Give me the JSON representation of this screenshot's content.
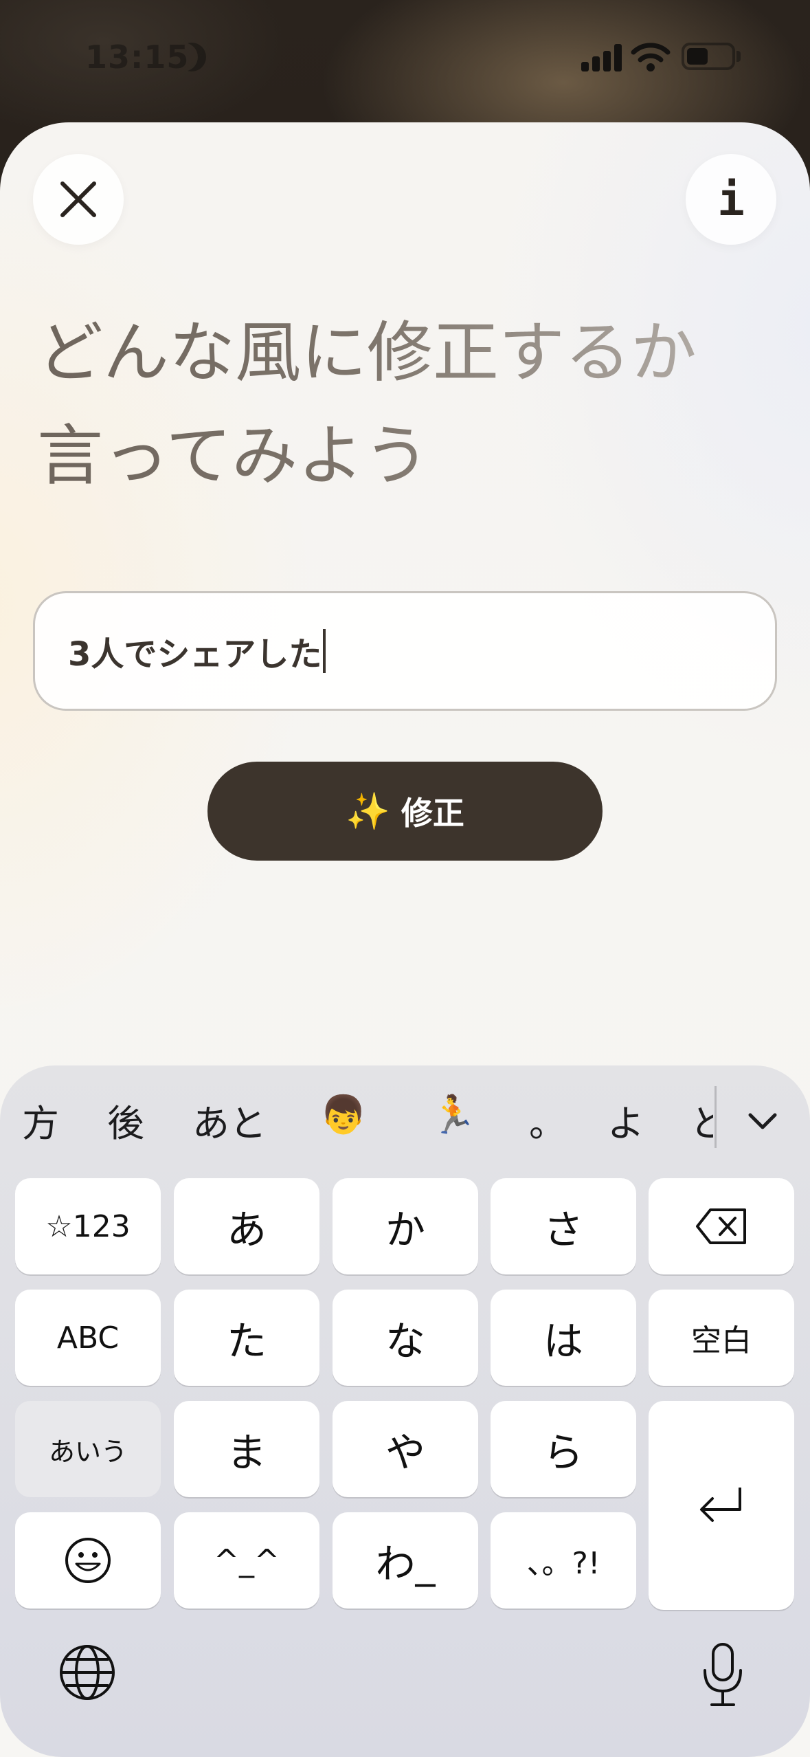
{
  "status_bar": {
    "time": "13:15"
  },
  "header": {
    "close_icon": "close-icon",
    "info_icon": "info-icon",
    "info_glyph": "i"
  },
  "prompt": {
    "line1": "どんな風に修正するか",
    "line2": "言ってみよう"
  },
  "input": {
    "value": "3人でシェアした"
  },
  "fix_button": {
    "icon": "✨",
    "label": "修正"
  },
  "keyboard": {
    "suggestions": [
      "方",
      "後",
      "あと",
      "👦",
      "🏃",
      "。",
      "よ",
      "と"
    ],
    "keys": {
      "numbers": "☆123",
      "a": "あ",
      "ka": "か",
      "sa": "さ",
      "abc": "ABC",
      "ta": "た",
      "na": "な",
      "ha": "は",
      "space": "空白",
      "aiu": "あいう",
      "ma": "ま",
      "ya": "や",
      "ra": "ら",
      "kaomoji": "^_^",
      "wa": "わ_",
      "punct": "、。?!"
    }
  }
}
